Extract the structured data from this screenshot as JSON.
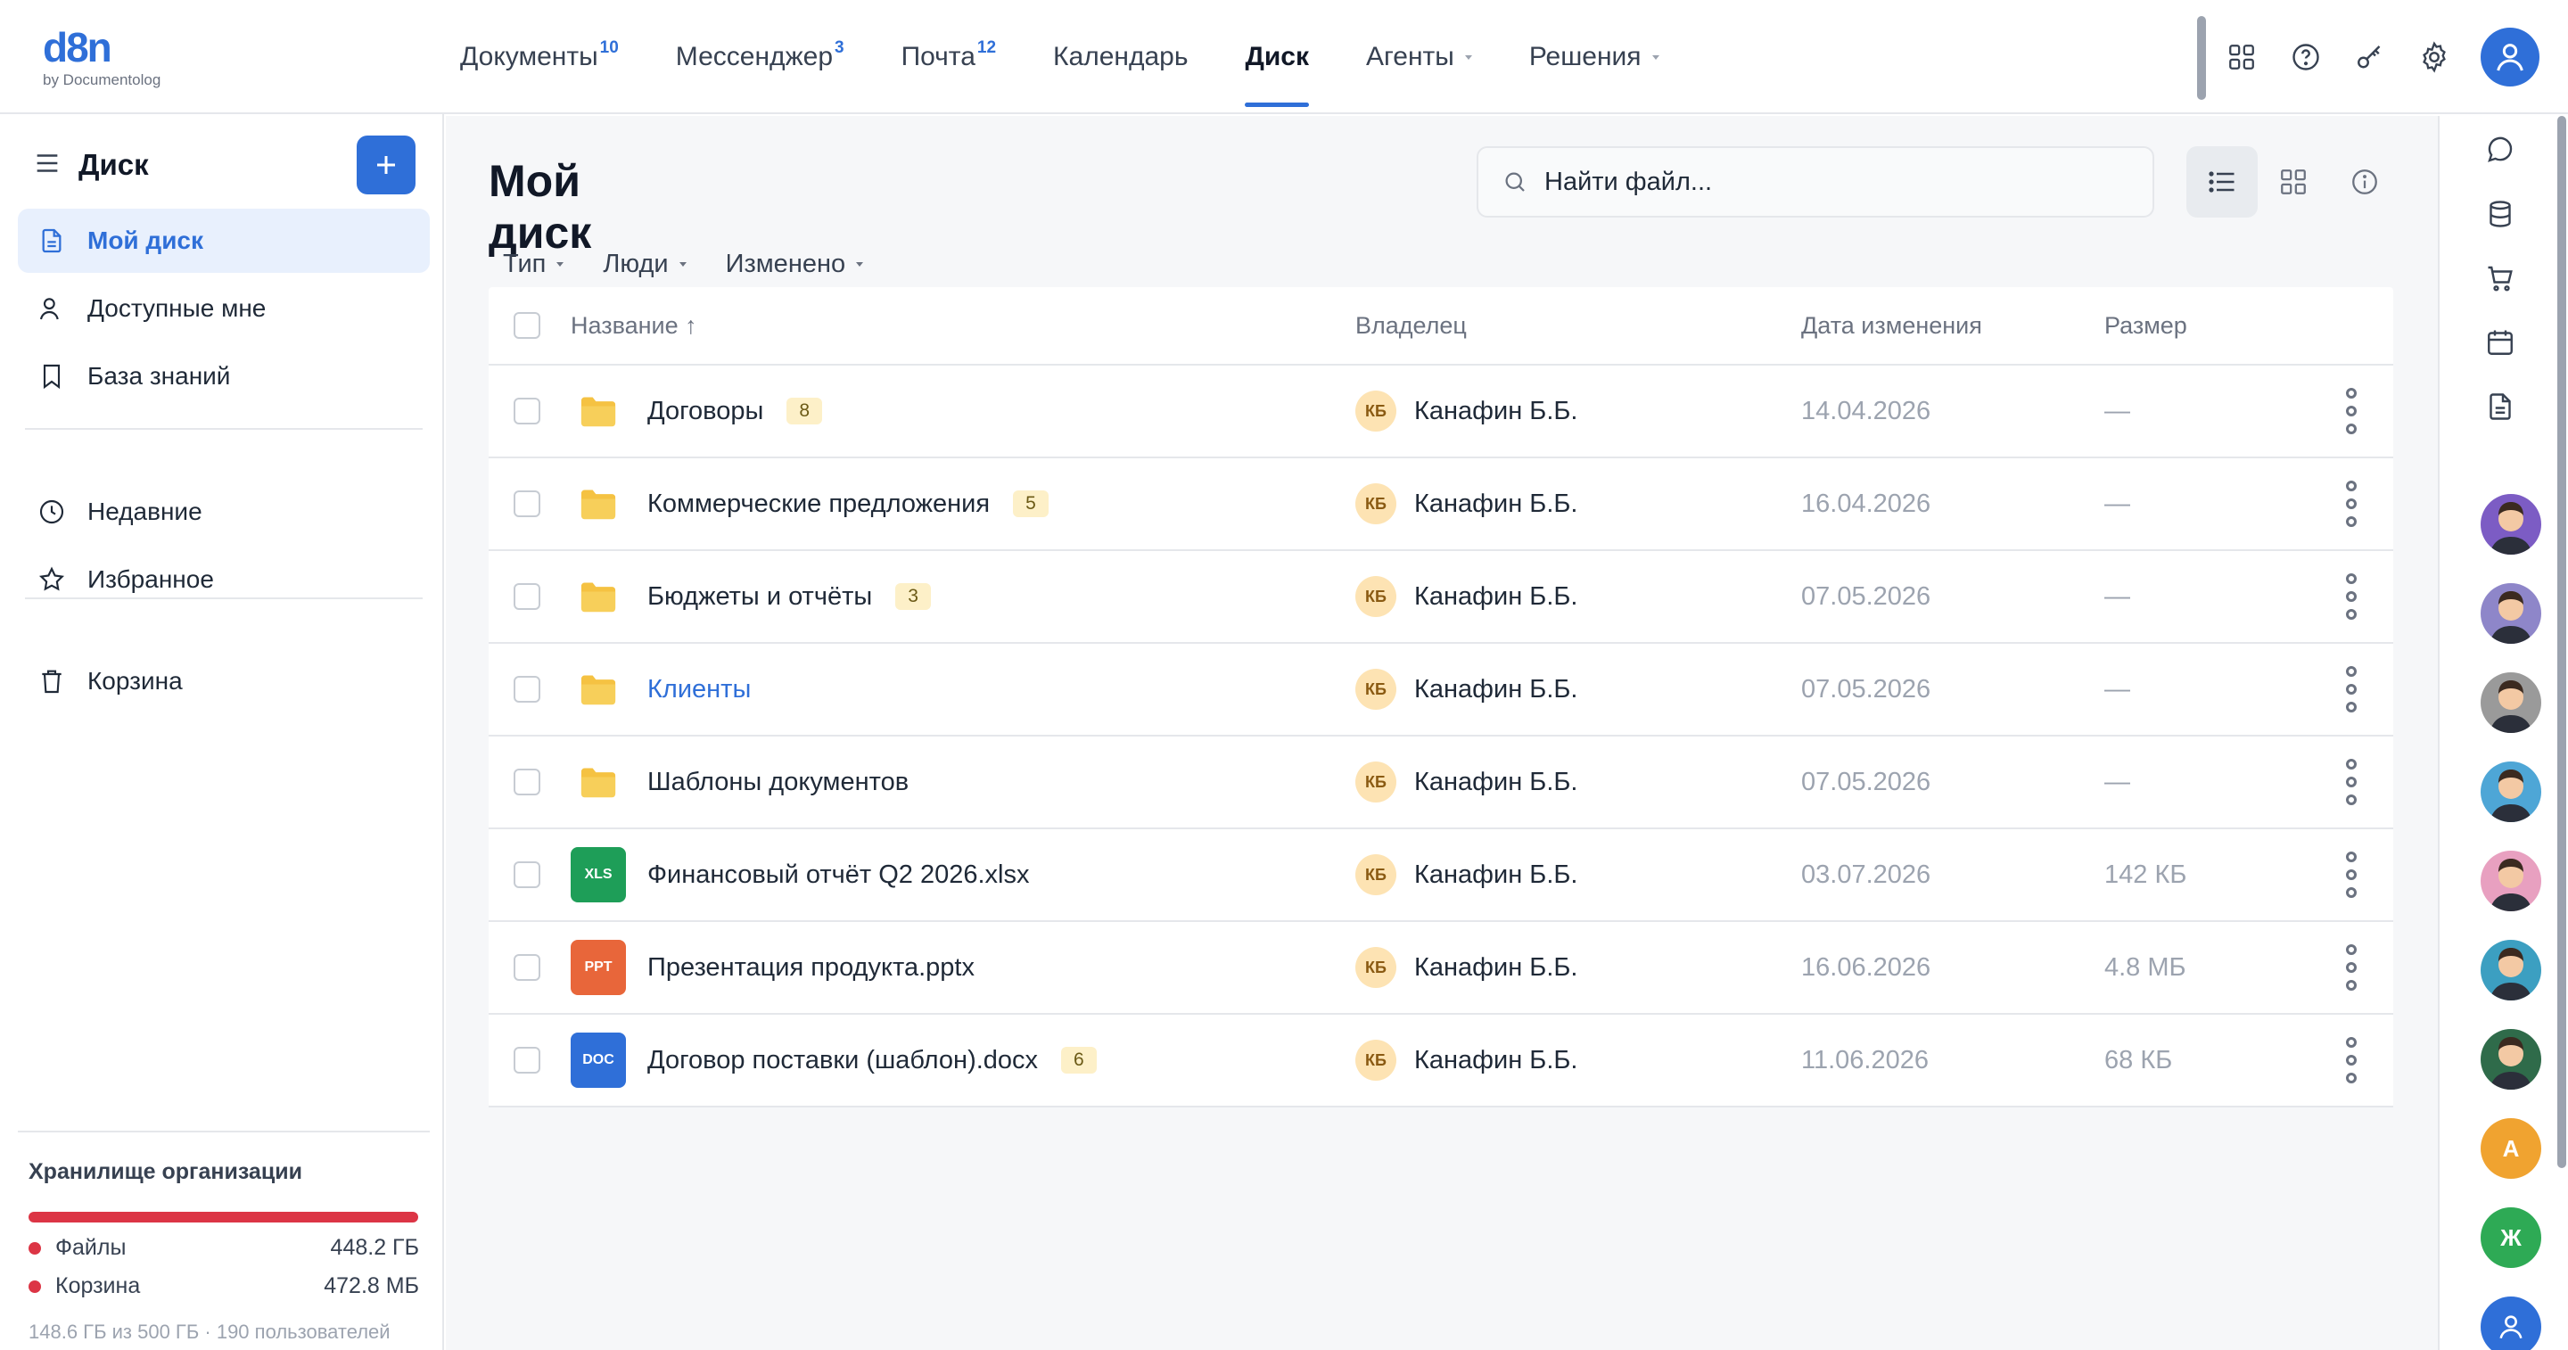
{
  "logo": {
    "main": "d8n",
    "sub": "by Documentolog"
  },
  "nav": [
    {
      "label": "Документы",
      "badge": "10"
    },
    {
      "label": "Мессенджер",
      "badge": "3"
    },
    {
      "label": "Почта",
      "badge": "12"
    },
    {
      "label": "Календарь",
      "badge": ""
    },
    {
      "label": "Диск",
      "badge": "",
      "active": true
    },
    {
      "label": "Агенты",
      "badge": "",
      "caret": true
    },
    {
      "label": "Решения",
      "badge": "",
      "caret": true
    }
  ],
  "top_icons": [
    "apps-grid-icon",
    "help-icon",
    "key-icon",
    "settings-gear-icon",
    "user-avatar-icon"
  ],
  "sidebar": {
    "title": "Диск",
    "items": [
      {
        "label": "Мой диск",
        "icon": "document-icon",
        "active": true
      },
      {
        "label": "Доступные мне",
        "icon": "person-icon"
      },
      {
        "label": "База знаний",
        "icon": "bookmark-icon"
      },
      {
        "label": "Недавние",
        "icon": "clock-icon"
      },
      {
        "label": "Избранное",
        "icon": "star-icon"
      },
      {
        "label": "Корзина",
        "icon": "trash-icon"
      }
    ],
    "storage": {
      "title": "Хранилище организации",
      "used_fraction": 0.998,
      "rows": [
        {
          "label": "Файлы",
          "value": "448.2 ГБ"
        },
        {
          "label": "Корзина",
          "value": "472.8 МБ"
        }
      ],
      "footer": "148.6 ГБ из 500 ГБ · 190 пользователей"
    }
  },
  "main": {
    "title": "Мой диск",
    "search_placeholder": "Найти файл...",
    "filters": [
      "Тип",
      "Люди",
      "Изменено"
    ],
    "columns": {
      "name": "Название ↑",
      "owner": "Владелец",
      "date": "Дата изменения",
      "size": "Размер"
    },
    "rows": [
      {
        "type": "folder",
        "name": "Договоры",
        "count": "8",
        "owner_initials": "КБ",
        "owner": "Канафин Б.Б.",
        "date": "14.04.2026",
        "size": "—"
      },
      {
        "type": "folder",
        "name": "Коммерческие предложения",
        "count": "5",
        "owner_initials": "КБ",
        "owner": "Канафин Б.Б.",
        "date": "16.04.2026",
        "size": "—"
      },
      {
        "type": "folder",
        "name": "Бюджеты и отчёты",
        "count": "3",
        "owner_initials": "КБ",
        "owner": "Канафин Б.Б.",
        "date": "07.05.2026",
        "size": "—"
      },
      {
        "type": "folder",
        "name": "Клиенты",
        "count": "",
        "link": true,
        "owner_initials": "КБ",
        "owner": "Канафин Б.Б.",
        "date": "07.05.2026",
        "size": "—"
      },
      {
        "type": "folder",
        "name": "Шаблоны документов",
        "count": "",
        "owner_initials": "КБ",
        "owner": "Канафин Б.Б.",
        "date": "07.05.2026",
        "size": "—"
      },
      {
        "type": "xls",
        "badge": "XLS",
        "name": "Финансовый отчёт Q2 2026.xlsx",
        "count": "",
        "owner_initials": "КБ",
        "owner": "Канафин Б.Б.",
        "date": "03.07.2026",
        "size": "142 КБ"
      },
      {
        "type": "ppt",
        "badge": "PPT",
        "name": "Презентация продукта.pptx",
        "count": "",
        "owner_initials": "КБ",
        "owner": "Канафин Б.Б.",
        "date": "16.06.2026",
        "size": "4.8 МБ"
      },
      {
        "type": "doc",
        "badge": "DOC",
        "name": "Договор поставки (шаблон).docx",
        "count": "6",
        "owner_initials": "КБ",
        "owner": "Канафин Б.Б.",
        "date": "11.06.2026",
        "size": "68 КБ"
      }
    ]
  },
  "file_colors": {
    "folder": "#f5c242",
    "xls": "#1e9e58",
    "ppt": "#e8663a",
    "doc": "#2f6fd8"
  },
  "rail": {
    "icons": [
      "chat-icon",
      "database-icon",
      "cart-icon",
      "calendar-icon",
      "document-list-icon"
    ],
    "avatars": [
      {
        "kind": "photo",
        "bg": "#7c5cc4"
      },
      {
        "kind": "photo",
        "bg": "#8e86c9"
      },
      {
        "kind": "photo",
        "bg": "#9a9a9a"
      },
      {
        "kind": "photo",
        "bg": "#4ea6d6"
      },
      {
        "kind": "photo",
        "bg": "#e8a0c0"
      },
      {
        "kind": "photo",
        "bg": "#3c9fc1"
      },
      {
        "kind": "photo",
        "bg": "#2f6b4a"
      },
      {
        "kind": "letter",
        "letter": "А",
        "bg": "#f0a330"
      },
      {
        "kind": "letter",
        "letter": "Ж",
        "bg": "#2eaa55"
      },
      {
        "kind": "icon",
        "bg": "#2f6fd8"
      }
    ]
  }
}
